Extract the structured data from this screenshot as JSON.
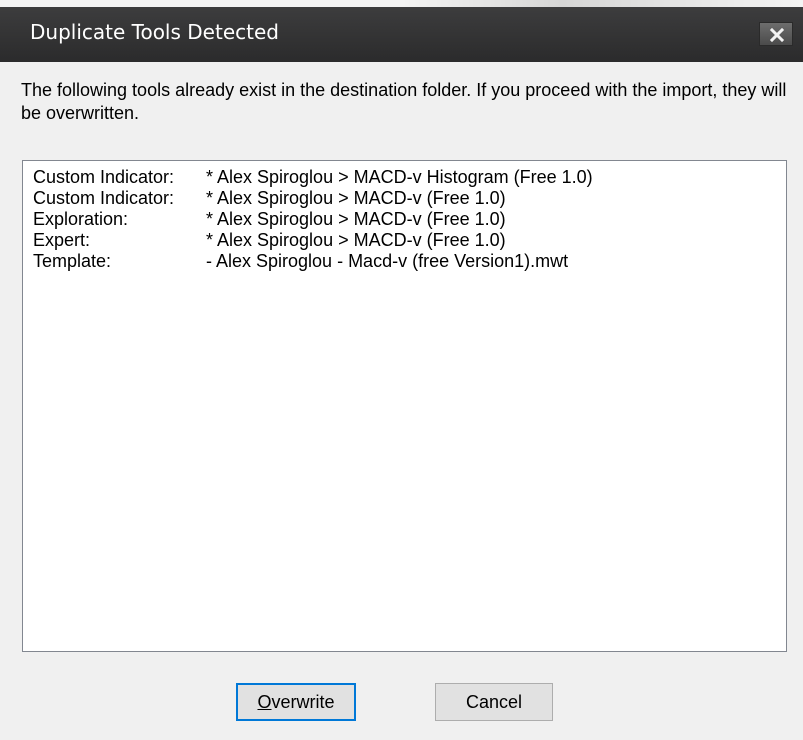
{
  "dialog": {
    "title": "Duplicate Tools Detected",
    "message": "The following tools already exist in the destination folder.  If you proceed with the import, they will be overwritten."
  },
  "tools": [
    {
      "type": "Custom Indicator:",
      "name": "* Alex Spiroglou > MACD-v Histogram (Free 1.0)"
    },
    {
      "type": "Custom Indicator:",
      "name": "* Alex Spiroglou > MACD-v (Free 1.0)"
    },
    {
      "type": "Exploration:",
      "name": "* Alex Spiroglou > MACD-v (Free 1.0)"
    },
    {
      "type": "Expert:",
      "name": "* Alex Spiroglou > MACD-v (Free 1.0)"
    },
    {
      "type": "Template:",
      "name": "- Alex Spiroglou - Macd-v (free Version1).mwt"
    }
  ],
  "buttons": {
    "overwrite_first": "O",
    "overwrite_rest": "verwrite",
    "cancel": "Cancel"
  },
  "colors": {
    "titlebar": "#2b2b2c",
    "default_button_border": "#0078d7",
    "dialog_bg": "#f0f0f0"
  },
  "icons": {
    "close": "close-icon"
  }
}
